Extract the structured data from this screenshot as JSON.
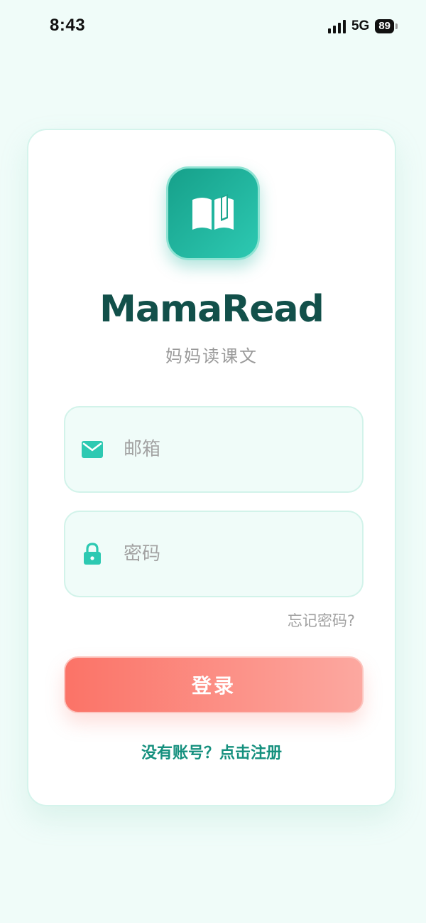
{
  "status_bar": {
    "time": "8:43",
    "network": "5G",
    "battery": "89"
  },
  "brand": {
    "name": "MamaRead",
    "subtitle": "妈妈读课文",
    "logo_icon": "open-book-icon",
    "logo_color": "#1aa58e"
  },
  "form": {
    "email": {
      "icon": "mail-icon",
      "placeholder": "邮箱",
      "value": ""
    },
    "password": {
      "icon": "lock-icon",
      "placeholder": "密码",
      "value": ""
    },
    "forgot_label": "忘记密码?",
    "login_label": "登录",
    "register_label": "没有账号？点击注册"
  },
  "colors": {
    "accent": "#2dc9b2",
    "brand_text": "#12504a",
    "login_button": "#fb7367",
    "link": "#15907e"
  }
}
